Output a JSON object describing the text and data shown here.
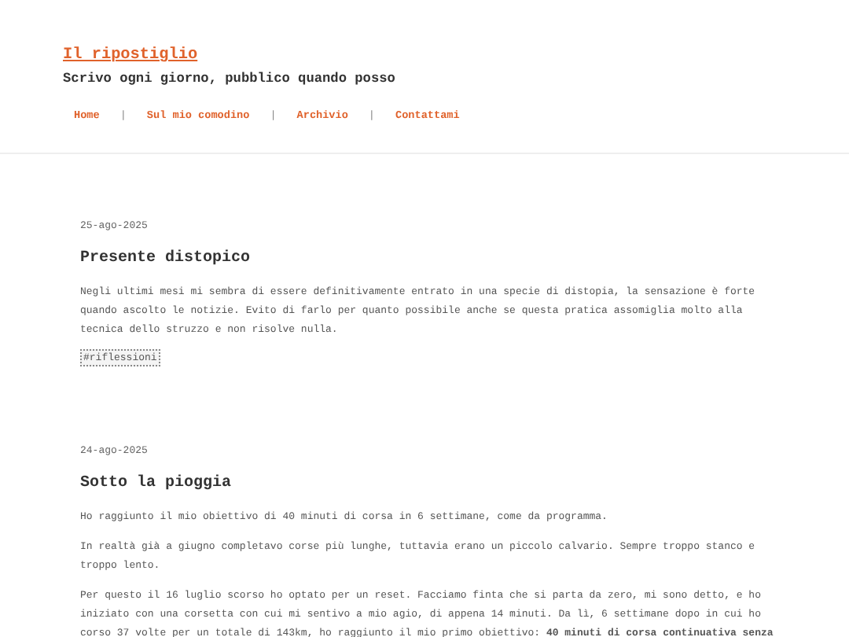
{
  "site": {
    "title": "Il ripostiglio",
    "tagline": "Scrivo ogni giorno, pubblico quando posso"
  },
  "nav": [
    {
      "label": "Home"
    },
    {
      "label": "Sul mio comodino"
    },
    {
      "label": "Archivio"
    },
    {
      "label": "Contattami"
    }
  ],
  "nav_separator": "|",
  "posts": [
    {
      "date": "25-ago-2025",
      "title": "Presente distopico",
      "paragraphs": [
        "Negli ultimi mesi mi sembra di essere definitivamente entrato in una specie di distopia, la sensazione è forte quando ascolto le notizie. Evito di farlo per quanto possibile anche se questa pratica assomiglia molto alla tecnica dello struzzo e non risolve nulla."
      ],
      "tags": [
        "#riflessioni"
      ]
    },
    {
      "date": "24-ago-2025",
      "title": "Sotto la pioggia",
      "paragraphs": [
        "Ho raggiunto il mio obiettivo di 40 minuti di corsa in 6 settimane, come da programma.",
        "In realtà già a giugno completavo corse più lunghe, tuttavia erano un piccolo calvario. Sempre troppo stanco e troppo lento.",
        "Per questo il 16 luglio scorso ho optato per un reset. Facciamo finta che si parta da zero, mi sono detto, e ho iniziato con una corsetta con cui mi sentivo a mio agio, di appena 14 minuti. Da lì, 6 settimane dopo in cui ho corso 37 volte per un totale di 143km, ho raggiunto il mio primo obiettivo: **40 minuti di corsa continuativa senza**"
      ]
    }
  ]
}
